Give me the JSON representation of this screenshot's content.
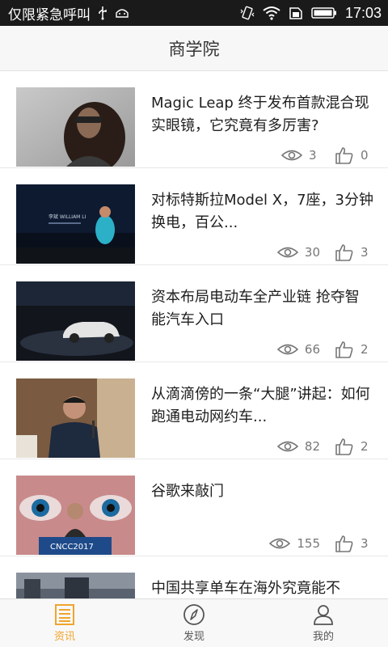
{
  "status_bar": {
    "carrier_text": "仅限紧急呼叫",
    "time": "17:03",
    "icons": [
      "usb-icon",
      "android-debug-icon",
      "vibrate-icon",
      "wifi-icon",
      "sim-icon",
      "battery-icon"
    ]
  },
  "header": {
    "title": "商学院"
  },
  "articles": [
    {
      "title": "Magic Leap 终于发布首款混合现实眼镜，它究竟有多厉害?",
      "views": "3",
      "likes": "0"
    },
    {
      "title": "对标特斯拉Model X，7座，3分钟换电，百公...",
      "views": "30",
      "likes": "3"
    },
    {
      "title": "资本布局电动车全产业链 抢夺智能汽车入口",
      "views": "66",
      "likes": "2"
    },
    {
      "title": "从滴滴傍的一条“大腿”讲起：如何跑通电动网约车...",
      "views": "82",
      "likes": "2"
    },
    {
      "title": "谷歌来敲门",
      "views": "155",
      "likes": "3"
    },
    {
      "title": "中国共享单车在海外究竟能不",
      "views": "",
      "likes": ""
    }
  ],
  "thumb_texts": {
    "william_li_caption": "李斌 WILLIAM LI",
    "cncc_sign": "CNCC2017"
  },
  "tabs": [
    {
      "label": "资讯",
      "icon": "news-icon",
      "active": true
    },
    {
      "label": "发现",
      "icon": "compass-icon",
      "active": false
    },
    {
      "label": "我的",
      "icon": "user-icon",
      "active": false
    }
  ],
  "colors": {
    "status_bar_bg": "#1a1a1a",
    "accent": "#f0a52e",
    "header_bg": "#f7f7f7",
    "stat_gray": "#777777"
  }
}
